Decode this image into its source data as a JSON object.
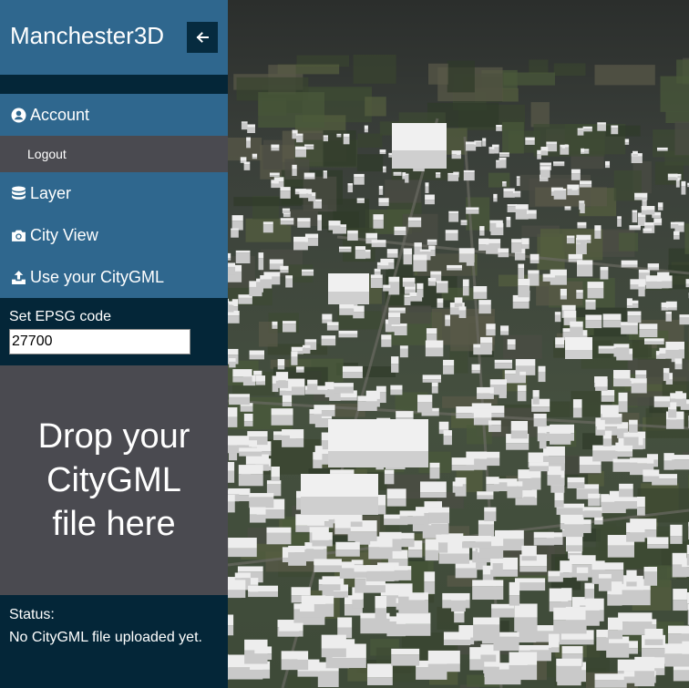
{
  "app": {
    "title": "Manchester3D"
  },
  "sidebar": {
    "collapse_icon": "arrow-left-icon",
    "menu": {
      "account": {
        "label": "Account",
        "icon": "user-circle-icon"
      },
      "logout": {
        "label": "Logout"
      },
      "layer": {
        "label": "Layer",
        "icon": "database-icon"
      },
      "city_view": {
        "label": "City View",
        "icon": "camera-icon"
      },
      "use_citygml": {
        "label": "Use your CityGML",
        "icon": "upload-icon"
      }
    },
    "epsg": {
      "label": "Set EPSG code",
      "value": "27700"
    },
    "dropzone": {
      "line1": "Drop your",
      "line2": "CityGML",
      "line3": "file here"
    },
    "status": {
      "label": "Status:",
      "text": "No CityGML file uploaded yet."
    }
  },
  "colors": {
    "header_bg": "#2f678e",
    "sidebar_bg": "#042638",
    "dropzone_bg": "#4a4a50"
  }
}
